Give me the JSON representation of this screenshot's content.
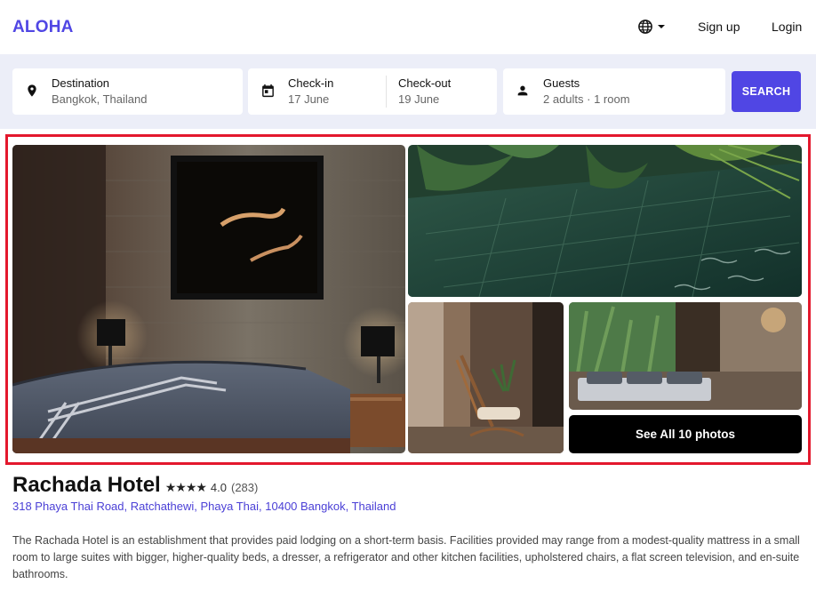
{
  "header": {
    "logo": "ALOHA",
    "signup_label": "Sign up",
    "login_label": "Login",
    "language_icon": "globe-icon"
  },
  "search": {
    "destination": {
      "label": "Destination",
      "value": "Bangkok, Thailand",
      "icon": "location-pin-icon"
    },
    "checkin": {
      "label": "Check-in",
      "value": "17 June",
      "icon": "calendar-icon"
    },
    "checkout": {
      "label": "Check-out",
      "value": "19 June"
    },
    "guests": {
      "label": "Guests",
      "value": "2 adults · 1 room",
      "icon": "person-icon"
    },
    "search_label": "SEARCH"
  },
  "gallery": {
    "see_all_label": "See All 10 photos",
    "photos": [
      "bedroom-photo",
      "pool-photo",
      "chair-photo",
      "lounge-photo"
    ]
  },
  "hotel": {
    "name": "Rachada Hotel",
    "stars": "★★★★",
    "rating": "4.0",
    "reviews": "(283)",
    "address": "318 Phaya Thai Road, Ratchathewi, Phaya Thai, 10400 Bangkok, Thailand",
    "description": "The Rachada Hotel is an establishment that provides paid lodging on a short-term basis. Facilities provided may range from a modest-quality mattress in a small room to large suites with bigger, higher-quality beds, a dresser, a refrigerator and other kitchen facilities, upholstered chairs, a flat screen television, and en-suite bathrooms."
  },
  "colors": {
    "brand": "#5046e4",
    "highlight_border": "#e3182d",
    "search_band_bg": "#eceef8"
  }
}
